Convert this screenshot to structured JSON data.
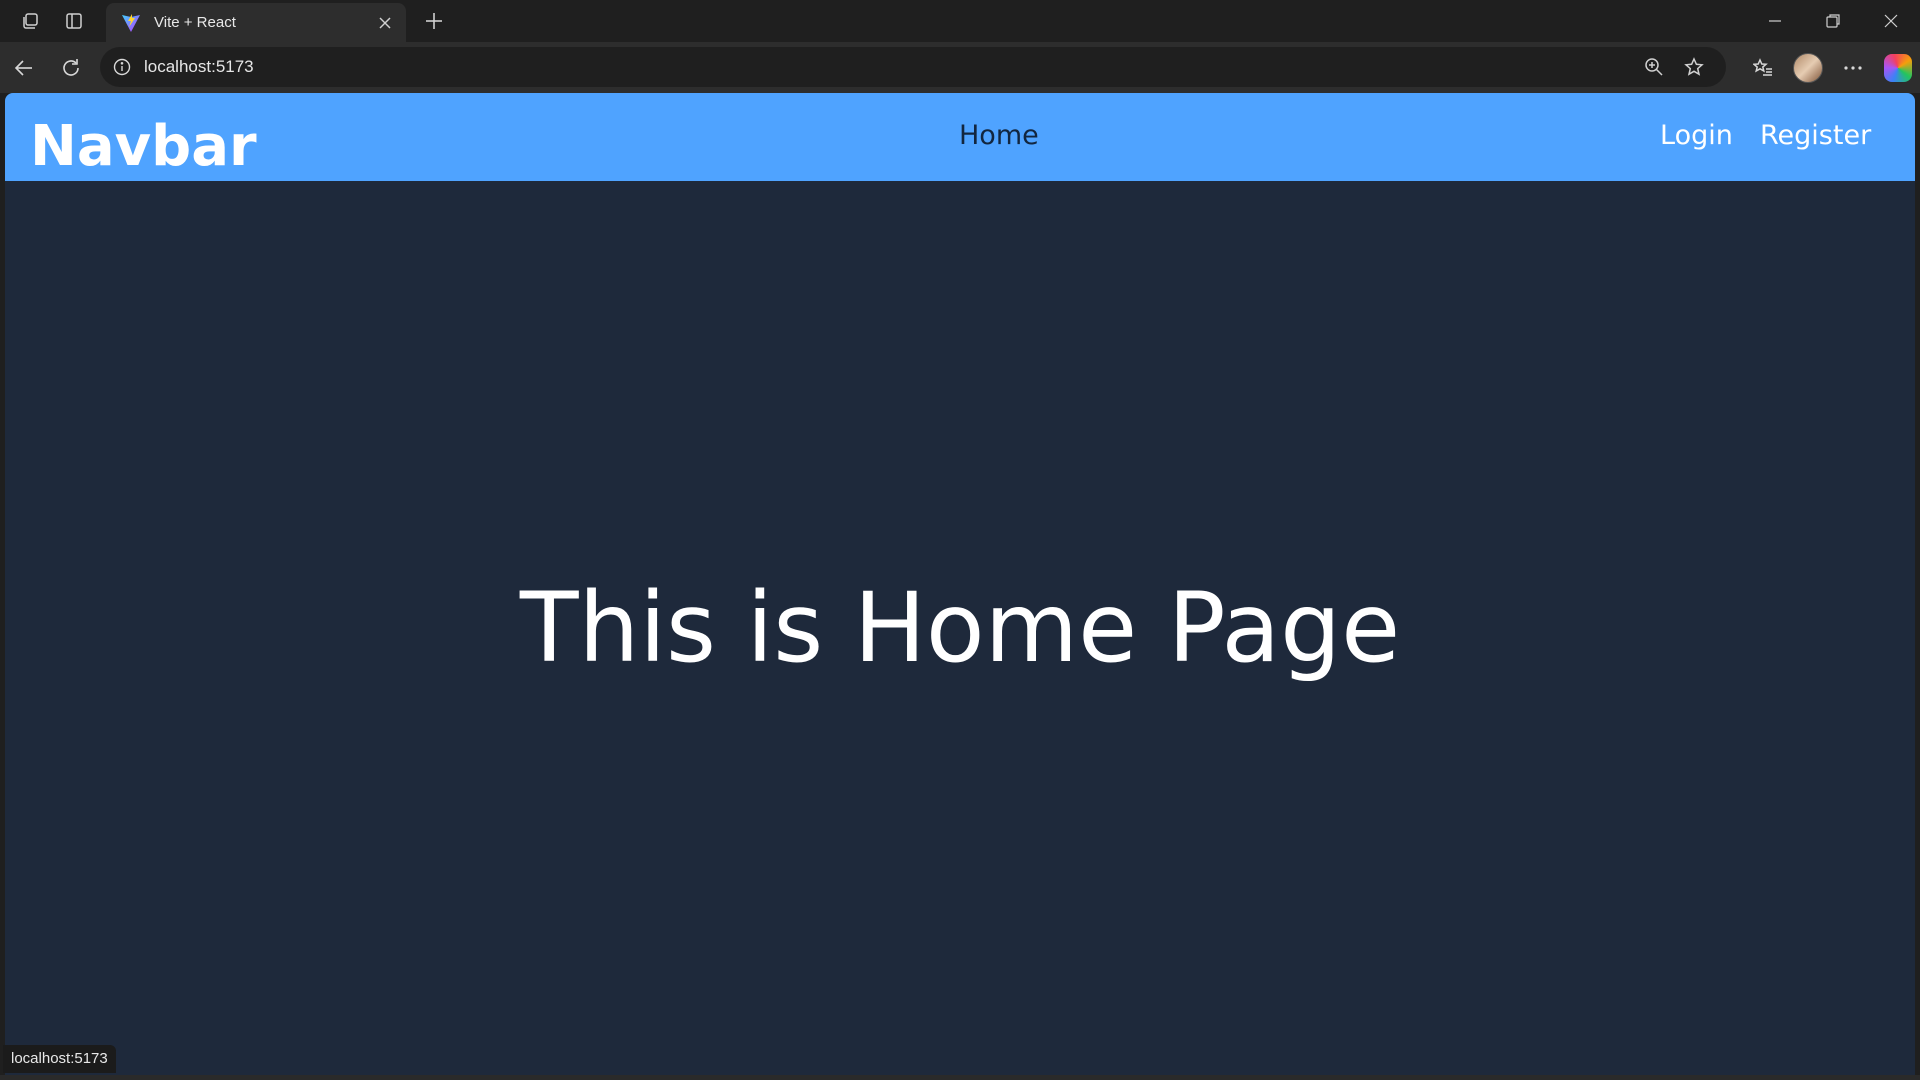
{
  "browser": {
    "tab": {
      "title": "Vite + React",
      "favicon": "vite-logo-icon"
    },
    "address": {
      "url": "localhost:5173"
    },
    "status_link": "localhost:5173"
  },
  "page": {
    "colors": {
      "navbar_bg": "#4fa3ff",
      "page_bg": "#1e293b",
      "home_link": "#12263f",
      "text": "#ffffff"
    },
    "navbar": {
      "brand": "Navbar",
      "links": {
        "home": "Home",
        "login": "Login",
        "register": "Register"
      }
    },
    "heading": "This is Home Page"
  }
}
